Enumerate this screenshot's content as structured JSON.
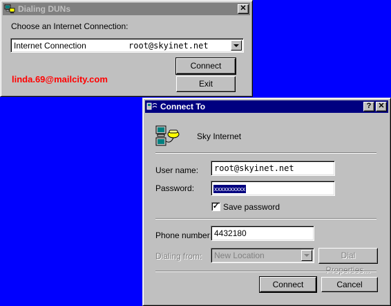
{
  "dialing_window": {
    "title": "Dialing DUNs",
    "close_glyph": "✕",
    "prompt": "Choose an Internet Connection:",
    "connection_name": "Internet Connection",
    "connection_account": "root@skyinet.net",
    "connect_label": "Connect",
    "exit_label": "Exit",
    "email_text": "linda.69@mailcity.com",
    "email_color": "#ff0000"
  },
  "connect_dialog": {
    "title": "Connect To",
    "help_glyph": "?",
    "close_glyph": "✕",
    "connection_name": "Sky Internet",
    "username_label": "User name:",
    "username_value": "root@skyinet.net",
    "password_label": "Password:",
    "password_value": "xxxxxxxxxx",
    "save_password_label": "Save password",
    "save_password_checked": "✓",
    "phone_label": "Phone number:",
    "phone_value": "4432180",
    "dialing_from_label": "Dialing from:",
    "dialing_from_value": "New Location",
    "dial_properties_label": "Dial Properties...",
    "connect_label": "Connect",
    "cancel_label": "Cancel"
  },
  "colors": {
    "desktop": "#0000ff",
    "active_title": "#000080",
    "inactive_title": "#808080",
    "face": "#c0c0c0",
    "selection": "#000080"
  },
  "icons": [
    "dialup-network-icon",
    "dialup-computer-phone-icon"
  ]
}
